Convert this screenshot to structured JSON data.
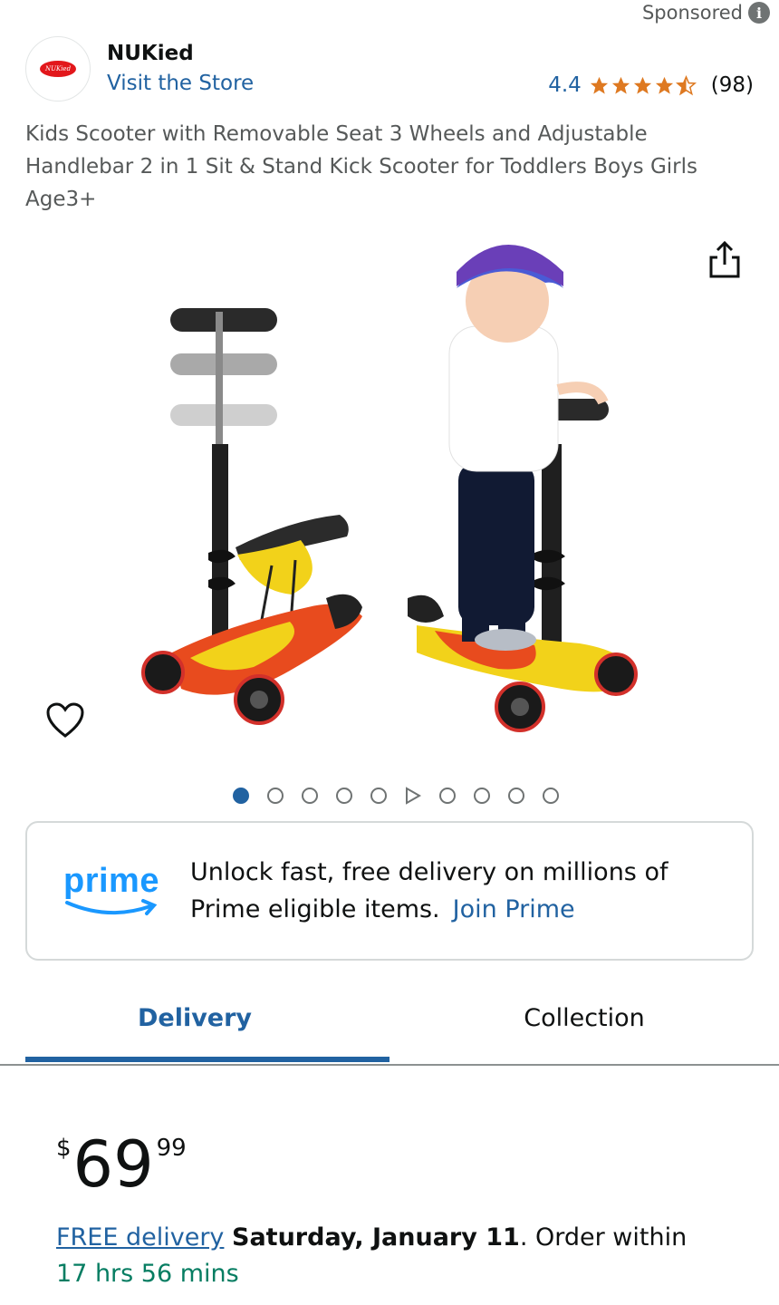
{
  "sponsored": {
    "label": "Sponsored",
    "icon": "info-icon"
  },
  "brand": {
    "logo_text": "NUKied",
    "name": "NUKied",
    "store_link": "Visit the Store"
  },
  "rating": {
    "value": "4.4",
    "stars": 4.4,
    "count": "(98)"
  },
  "product": {
    "title": "Kids Scooter with Removable Seat 3 Wheels and Adjustable Handlebar 2 in 1 Sit & Stand Kick Scooter for Toddlers Boys Girls Age3+"
  },
  "gallery": {
    "image_count": 10,
    "active_index": 0,
    "video_index": 5,
    "share_icon": "share-icon",
    "wishlist_icon": "heart-icon"
  },
  "prime": {
    "logo_word": "prime",
    "message": "Unlock fast, free delivery on millions of Prime eligible items.",
    "link": "Join Prime"
  },
  "tabs": [
    {
      "label": "Delivery",
      "active": true
    },
    {
      "label": "Collection",
      "active": false
    }
  ],
  "price": {
    "symbol": "$",
    "whole": "69",
    "fraction": "99"
  },
  "delivery": {
    "free_label": "FREE delivery",
    "date": "Saturday, January 11",
    "order_within": ". Order within ",
    "countdown": "17 hrs 56 mins"
  },
  "colors": {
    "link": "#2162a1",
    "star": "#de7921",
    "prime": "#1a98ff",
    "countdown": "#067d62"
  }
}
